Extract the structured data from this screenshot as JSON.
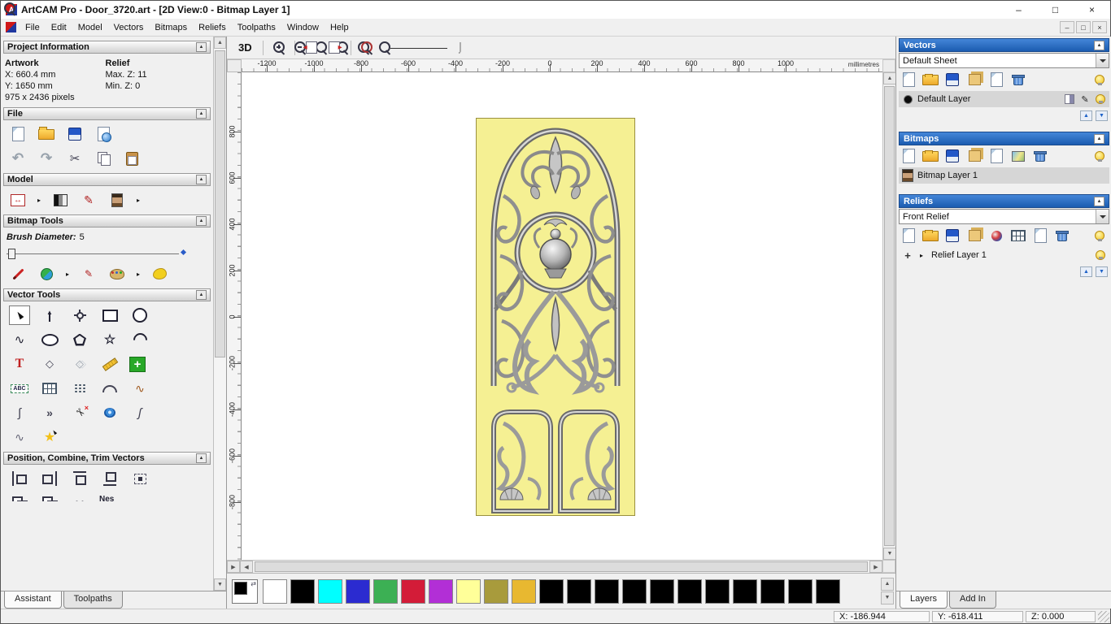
{
  "window": {
    "title": "ArtCAM Pro - Door_3720.art - [2D View:0 - Bitmap Layer 1]",
    "minimize": "–",
    "maximize": "□",
    "close": "×"
  },
  "menubar": {
    "items": [
      "File",
      "Edit",
      "Model",
      "Vectors",
      "Bitmaps",
      "Reliefs",
      "Toolpaths",
      "Window",
      "Help"
    ],
    "mdi_minimize": "–",
    "mdi_restore": "□",
    "mdi_close": "×"
  },
  "assistant": {
    "project": {
      "title": "Project Information",
      "artwork_heading": "Artwork",
      "relief_heading": "Relief",
      "artwork_x": "X: 660.4 mm",
      "artwork_y": "Y: 1650 mm",
      "relief_max": "Max. Z: 11",
      "relief_min": "Min. Z: 0",
      "pixels": "975 x 2436 pixels"
    },
    "file": {
      "title": "File",
      "row1": [
        "new-model-icon",
        "open-model-icon",
        "save-model-icon",
        "import-export-icon"
      ],
      "row2": [
        "undo-icon",
        "redo-icon",
        "cut-icon",
        "copy-icon",
        "paste-icon"
      ]
    },
    "model": {
      "title": "Model",
      "icons": [
        "set-model-size-icon",
        "flyout-arrow",
        "greyscale-view-icon",
        "sculpt-icon",
        "texture-image-icon",
        "flyout-arrow"
      ]
    },
    "bitmap_tools": {
      "title": "Bitmap Tools",
      "brush_label": "Brush Diameter:",
      "brush_value": "5",
      "icons": [
        "draw-icon",
        "flood-fill-icon",
        "flyout-arrow",
        "pixel-edit-icon",
        "palette-icon",
        "flyout-arrow",
        "fill-colour-icon"
      ]
    },
    "vector_tools": {
      "title": "Vector Tools",
      "row1": [
        "select-vectors-icon",
        "node-editing-icon",
        "transform-vectors-icon",
        "create-rectangle-icon",
        "create-circle-icon"
      ],
      "row2": [
        "create-polyline-icon",
        "create-ellipse-icon",
        "create-polygon-icon",
        "create-star-icon",
        "create-arc-icon"
      ],
      "row3": [
        "create-text-icon",
        "measure-icon",
        "offset-vector-icon",
        "dimension-icon",
        "block-copy-icon"
      ],
      "row4": [
        "wrap-text-icon",
        "grid-window-icon",
        "array-copy-icon",
        "fit-arcs-icon",
        "fit-spline-icon"
      ],
      "row5": [
        "freehand-icon",
        "join-vectors-icon",
        "trim-vectors-icon",
        "extrude-icon",
        "spline-smooth-icon"
      ],
      "row6": [
        "profile-icon",
        "distort-vectors-icon"
      ]
    },
    "position_tools": {
      "title": "Position, Combine, Trim Vectors",
      "row1": [
        "align-left-icon",
        "align-right-icon",
        "align-top-icon",
        "align-bottom-icon",
        "align-centre-icon"
      ],
      "row2": [
        "weld-vectors-icon",
        "subtract-vectors-icon",
        "spaced-dots-icon"
      ],
      "nesting_label": "Nes"
    },
    "tabs": {
      "assistant": "Assistant",
      "toolpaths": "Toolpaths"
    }
  },
  "canvas": {
    "toolbar": {
      "view3d": "3D",
      "zoom_icons": [
        "zoom-in-icon",
        "zoom-out-icon",
        "zoom-object-icon",
        "zoom-window-icon",
        "zoom-fit-icon",
        "zoom-previous-icon"
      ],
      "dock_icons": [
        "dock-left-icon",
        "dock-right-icon"
      ],
      "extra_icons": [
        "zoom-back-icon"
      ]
    },
    "hruler": [
      "-1200",
      "-1000",
      "-800",
      "-600",
      "-400",
      "-200",
      "0",
      "200",
      "400",
      "600",
      "800",
      "1000"
    ],
    "hruler_unit": "millimetres",
    "vruler": [
      "800",
      "600",
      "400",
      "200",
      "0",
      "-200",
      "-400",
      "-600",
      "-800"
    ]
  },
  "palette": {
    "colors": [
      "#ffffff",
      "#000000",
      "#00ffff",
      "#2b2bd0",
      "#3cb054",
      "#d31c38",
      "#b22fd6",
      "#ffff99",
      "#a89b3c",
      "#e8b830",
      "#000000",
      "#000000",
      "#000000",
      "#000000",
      "#000000",
      "#000000",
      "#000000",
      "#000000",
      "#000000",
      "#000000",
      "#000000"
    ]
  },
  "layers_panel": {
    "vectors": {
      "title": "Vectors",
      "sheet": "Default Sheet",
      "toolbar": [
        "new-sheet-icon",
        "open-vectors-icon",
        "save-vectors-icon",
        "import-vectors-icon",
        "copy-sheet-icon",
        "delete-vectors-icon",
        "all-vectors-visibility-icon"
      ],
      "layer_name": "Default Layer",
      "left_icons": [
        "layer-colour-icon"
      ],
      "right_icons": [
        "snap-toggle-icon",
        "edit-layer-icon",
        "layer-visibility-icon"
      ],
      "updown": [
        "move-layer-up-icon",
        "move-layer-down-icon"
      ]
    },
    "bitmaps": {
      "title": "Bitmaps",
      "toolbar": [
        "new-bitmap-layer-icon",
        "open-bitmap-icon",
        "save-bitmap-icon",
        "merge-bitmaps-icon",
        "copy-bitmap-icon",
        "bitmap-image-icon",
        "delete-bitmap-layer-icon",
        "all-bitmaps-visibility-icon"
      ],
      "layer_name": "Bitmap Layer 1",
      "left_icons": [
        "bitmap-thumbnail-icon"
      ]
    },
    "reliefs": {
      "title": "Reliefs",
      "relief": "Front Relief",
      "toolbar": [
        "new-relief-layer-icon",
        "open-relief-icon",
        "save-relief-icon",
        "merge-reliefs-icon",
        "relief-sphere-icon",
        "calculate-relief-icon",
        "transfer-relief-icon",
        "delete-relief-layer-icon",
        "relief-visibility-icon"
      ],
      "layer_name": "Relief Layer 1",
      "left_icons": [
        "add-layer-plus-icon",
        "flyout-arrow"
      ],
      "right_icons": [
        "relief-layer-visibility-icon"
      ],
      "updown": [
        "move-layer-up-icon",
        "move-layer-down-icon"
      ]
    },
    "tabs": {
      "layers": "Layers",
      "addin": "Add In"
    }
  },
  "statusbar": {
    "x": "X: -186.944",
    "y": "Y: -618.411",
    "z": "Z: 0.000"
  }
}
